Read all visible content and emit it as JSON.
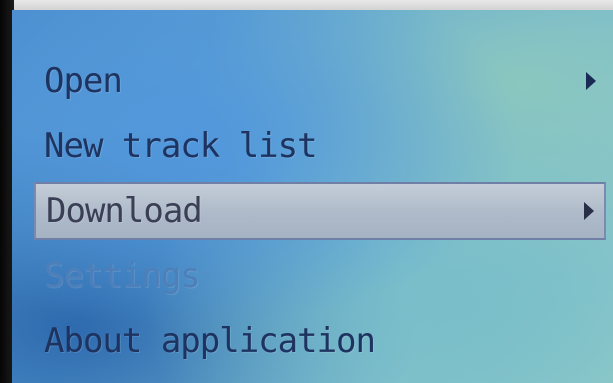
{
  "menu": {
    "items": [
      {
        "label": "Open",
        "has_submenu": true,
        "state": "normal"
      },
      {
        "label": "New track list",
        "has_submenu": false,
        "state": "normal"
      },
      {
        "label": "Download",
        "has_submenu": true,
        "state": "selected"
      },
      {
        "label": "Settings",
        "has_submenu": false,
        "state": "disabled"
      },
      {
        "label": "About application",
        "has_submenu": false,
        "state": "normal"
      }
    ]
  },
  "icons": {
    "submenu_arrow": "submenu-arrow-icon"
  },
  "colors": {
    "text": "#1e3360",
    "text_disabled": "#4f7fb8",
    "selection_highlight": "#b4bfcd",
    "screen_background": "#5fa4d6"
  }
}
